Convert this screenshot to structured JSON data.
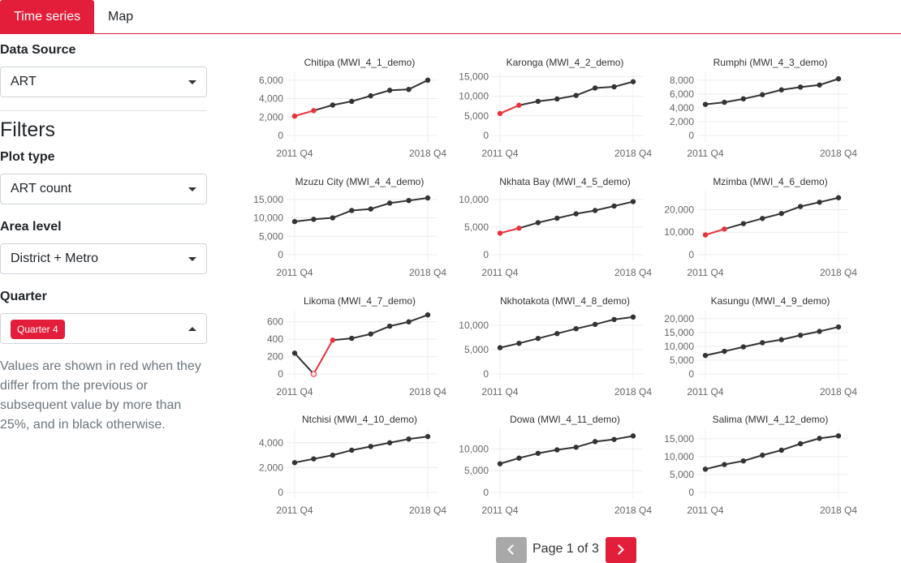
{
  "tabs": [
    {
      "label": "Time series",
      "active": true
    },
    {
      "label": "Map",
      "active": false
    }
  ],
  "sidebar": {
    "data_source_label": "Data Source",
    "data_source_value": "ART",
    "filters_heading": "Filters",
    "plot_type_label": "Plot type",
    "plot_type_value": "ART count",
    "area_level_label": "Area level",
    "area_level_value": "District + Metro",
    "quarter_label": "Quarter",
    "quarter_chip": "Quarter 4",
    "note": "Values are shown in red when they differ from the previous or subsequent value by more than 25%, and in black otherwise."
  },
  "pagination": {
    "text": "Page 1 of 3"
  },
  "colors": {
    "accent": "#e31e3a",
    "line": "#333333",
    "flag": "#e8313c"
  },
  "chart_data": [
    {
      "type": "line",
      "title": "Chitipa (MWI_4_1_demo)",
      "x": [
        "2011 Q4",
        "2012 Q4",
        "2013 Q4",
        "2014 Q4",
        "2015 Q4",
        "2016 Q4",
        "2017 Q4",
        "2018 Q4"
      ],
      "x_ticks": [
        "2011 Q4",
        "2018 Q4"
      ],
      "y_ticks": [
        0,
        2000,
        4000,
        6000
      ],
      "ylim": [
        0,
        6600
      ],
      "values": [
        2100,
        2700,
        3300,
        3700,
        4300,
        4900,
        5000,
        6000
      ],
      "red_segments": [
        0
      ],
      "red_points": [
        0,
        1
      ]
    },
    {
      "type": "line",
      "title": "Karonga (MWI_4_2_demo)",
      "x": [
        "2011 Q4",
        "2012 Q4",
        "2013 Q4",
        "2014 Q4",
        "2015 Q4",
        "2016 Q4",
        "2017 Q4",
        "2018 Q4"
      ],
      "x_ticks": [
        "2011 Q4",
        "2018 Q4"
      ],
      "y_ticks": [
        0,
        5000,
        10000,
        15000
      ],
      "ylim": [
        0,
        15500
      ],
      "values": [
        5600,
        7700,
        8700,
        9300,
        10200,
        12100,
        12400,
        13700
      ],
      "red_segments": [
        0
      ],
      "red_points": [
        0,
        1
      ]
    },
    {
      "type": "line",
      "title": "Rumphi (MWI_4_3_demo)",
      "x": [
        "2011 Q4",
        "2012 Q4",
        "2013 Q4",
        "2014 Q4",
        "2015 Q4",
        "2016 Q4",
        "2017 Q4",
        "2018 Q4"
      ],
      "x_ticks": [
        "2011 Q4",
        "2018 Q4"
      ],
      "y_ticks": [
        0,
        2000,
        4000,
        6000,
        8000
      ],
      "ylim": [
        0,
        8800
      ],
      "values": [
        4500,
        4800,
        5300,
        5900,
        6600,
        7000,
        7300,
        8200
      ],
      "red_segments": [],
      "red_points": []
    },
    {
      "type": "line",
      "title": "Mzuzu City (MWI_4_4_demo)",
      "x": [
        "2011 Q4",
        "2012 Q4",
        "2013 Q4",
        "2014 Q4",
        "2015 Q4",
        "2016 Q4",
        "2017 Q4",
        "2018 Q4"
      ],
      "x_ticks": [
        "2011 Q4",
        "2018 Q4"
      ],
      "y_ticks": [
        0,
        5000,
        10000,
        15000
      ],
      "ylim": [
        0,
        16500
      ],
      "values": [
        9000,
        9600,
        10000,
        12000,
        12400,
        14000,
        14700,
        15400
      ],
      "red_segments": [],
      "red_points": []
    },
    {
      "type": "line",
      "title": "Nkhata Bay (MWI_4_5_demo)",
      "x": [
        "2011 Q4",
        "2012 Q4",
        "2013 Q4",
        "2014 Q4",
        "2015 Q4",
        "2016 Q4",
        "2017 Q4",
        "2018 Q4"
      ],
      "x_ticks": [
        "2011 Q4",
        "2018 Q4"
      ],
      "y_ticks": [
        0,
        5000,
        10000
      ],
      "ylim": [
        0,
        11000
      ],
      "values": [
        3900,
        4800,
        5800,
        6600,
        7400,
        8000,
        8800,
        9600
      ],
      "red_segments": [
        0
      ],
      "red_points": [
        0,
        1
      ]
    },
    {
      "type": "line",
      "title": "Mzimba (MWI_4_6_demo)",
      "x": [
        "2011 Q4",
        "2012 Q4",
        "2013 Q4",
        "2014 Q4",
        "2015 Q4",
        "2016 Q4",
        "2017 Q4",
        "2018 Q4"
      ],
      "x_ticks": [
        "2011 Q4",
        "2018 Q4"
      ],
      "y_ticks": [
        0,
        10000,
        20000
      ],
      "ylim": [
        0,
        27000
      ],
      "values": [
        8800,
        11400,
        13800,
        16100,
        18300,
        21400,
        23300,
        25300
      ],
      "red_segments": [
        0
      ],
      "red_points": [
        0,
        1
      ]
    },
    {
      "type": "line",
      "title": "Likoma (MWI_4_7_demo)",
      "x": [
        "2011 Q4",
        "2012 Q4",
        "2013 Q4",
        "2014 Q4",
        "2015 Q4",
        "2016 Q4",
        "2017 Q4",
        "2018 Q4"
      ],
      "x_ticks": [
        "2011 Q4",
        "2018 Q4"
      ],
      "y_ticks": [
        0,
        200,
        400,
        600
      ],
      "ylim": [
        0,
        700
      ],
      "values": [
        240,
        0,
        390,
        410,
        460,
        550,
        600,
        680
      ],
      "red_segments": [
        1
      ],
      "red_points": [
        1,
        2
      ],
      "hollow_points": [
        1
      ]
    },
    {
      "type": "line",
      "title": "Nkhotakota (MWI_4_8_demo)",
      "x": [
        "2011 Q4",
        "2012 Q4",
        "2013 Q4",
        "2014 Q4",
        "2015 Q4",
        "2016 Q4",
        "2017 Q4",
        "2018 Q4"
      ],
      "x_ticks": [
        "2011 Q4",
        "2018 Q4"
      ],
      "y_ticks": [
        0,
        5000,
        10000
      ],
      "ylim": [
        0,
        12500
      ],
      "values": [
        5400,
        6300,
        7300,
        8300,
        9300,
        10200,
        11200,
        11700
      ],
      "red_segments": [],
      "red_points": []
    },
    {
      "type": "line",
      "title": "Kasungu (MWI_4_9_demo)",
      "x": [
        "2011 Q4",
        "2012 Q4",
        "2013 Q4",
        "2014 Q4",
        "2015 Q4",
        "2016 Q4",
        "2017 Q4",
        "2018 Q4"
      ],
      "x_ticks": [
        "2011 Q4",
        "2018 Q4"
      ],
      "y_ticks": [
        0,
        5000,
        10000,
        15000,
        20000
      ],
      "ylim": [
        0,
        22000
      ],
      "values": [
        6700,
        8200,
        9800,
        11300,
        12400,
        14000,
        15400,
        17000
      ],
      "red_segments": [],
      "red_points": []
    },
    {
      "type": "line",
      "title": "Ntchisi (MWI_4_10_demo)",
      "x": [
        "2011 Q4",
        "2012 Q4",
        "2013 Q4",
        "2014 Q4",
        "2015 Q4",
        "2016 Q4",
        "2017 Q4",
        "2018 Q4"
      ],
      "x_ticks": [
        "2011 Q4",
        "2018 Q4"
      ],
      "y_ticks": [
        0,
        2000,
        4000
      ],
      "ylim": [
        0,
        4900
      ],
      "values": [
        2400,
        2700,
        3000,
        3400,
        3700,
        4000,
        4300,
        4500
      ],
      "red_segments": [],
      "red_points": []
    },
    {
      "type": "line",
      "title": "Dowa (MWI_4_11_demo)",
      "x": [
        "2011 Q4",
        "2012 Q4",
        "2013 Q4",
        "2014 Q4",
        "2015 Q4",
        "2016 Q4",
        "2017 Q4",
        "2018 Q4"
      ],
      "x_ticks": [
        "2011 Q4",
        "2018 Q4"
      ],
      "y_ticks": [
        0,
        5000,
        10000
      ],
      "ylim": [
        0,
        14000
      ],
      "values": [
        6600,
        7900,
        9000,
        9800,
        10400,
        11700,
        12200,
        13000
      ],
      "red_segments": [],
      "red_points": []
    },
    {
      "type": "line",
      "title": "Salima (MWI_4_12_demo)",
      "x": [
        "2011 Q4",
        "2012 Q4",
        "2013 Q4",
        "2014 Q4",
        "2015 Q4",
        "2016 Q4",
        "2017 Q4",
        "2018 Q4"
      ],
      "x_ticks": [
        "2011 Q4",
        "2018 Q4"
      ],
      "y_ticks": [
        0,
        5000,
        10000,
        15000
      ],
      "ylim": [
        0,
        17000
      ],
      "values": [
        6500,
        7800,
        8800,
        10400,
        11800,
        13600,
        15100,
        15800
      ],
      "red_segments": [],
      "red_points": []
    }
  ]
}
